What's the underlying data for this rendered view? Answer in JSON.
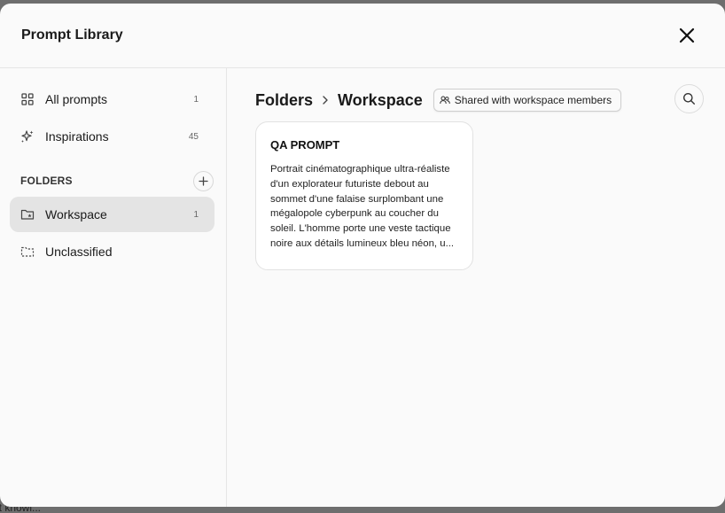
{
  "backdrop": {
    "text": "it knowl..."
  },
  "modal": {
    "title": "Prompt Library"
  },
  "sidebar": {
    "items": [
      {
        "label": "All prompts",
        "count": "1",
        "icon": "grid-icon"
      },
      {
        "label": "Inspirations",
        "count": "45",
        "icon": "sparkle-icon"
      }
    ],
    "folders_label": "FOLDERS",
    "folders": [
      {
        "label": "Workspace",
        "count": "1",
        "icon": "shared-folder-icon",
        "active": true
      },
      {
        "label": "Unclassified",
        "count": "",
        "icon": "dashed-folder-icon",
        "active": false
      }
    ]
  },
  "main": {
    "breadcrumb": [
      "Folders",
      "Workspace"
    ],
    "shared_badge": "Shared with workspace members",
    "cards": [
      {
        "title": "QA PROMPT",
        "text": "Portrait cinématographique ultra-réaliste d'un explorateur futuriste debout au sommet d'une falaise surplombant une mégalopole cyberpunk au coucher du soleil. L'homme porte une veste tactique noire aux détails lumineux bleu néon, u..."
      }
    ]
  },
  "colors": {
    "active_item_bg": "#e4e4e4",
    "backdrop": "#6e6e6e",
    "surface": "#fafafa"
  }
}
